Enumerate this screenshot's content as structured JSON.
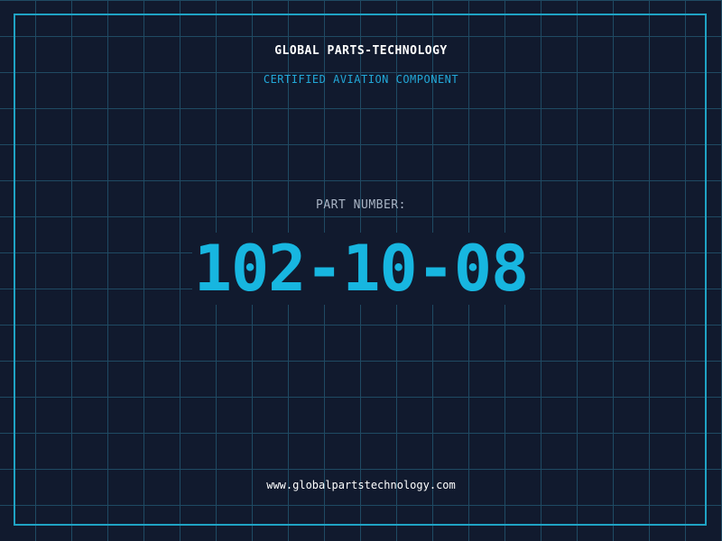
{
  "header": {
    "company_name": "GLOBAL PARTS-TECHNOLOGY",
    "tagline": "CERTIFIED AVIATION COMPONENT"
  },
  "part": {
    "label": "PART NUMBER:",
    "number": "102-10-08"
  },
  "footer": {
    "website": "www.globalpartstechnology.com"
  },
  "colors": {
    "background": "#111a2e",
    "grid": "#1f4a63",
    "frame": "#1fa3c4",
    "accent": "#17b6e0",
    "label": "#a9b4c4",
    "text": "#ffffff"
  }
}
